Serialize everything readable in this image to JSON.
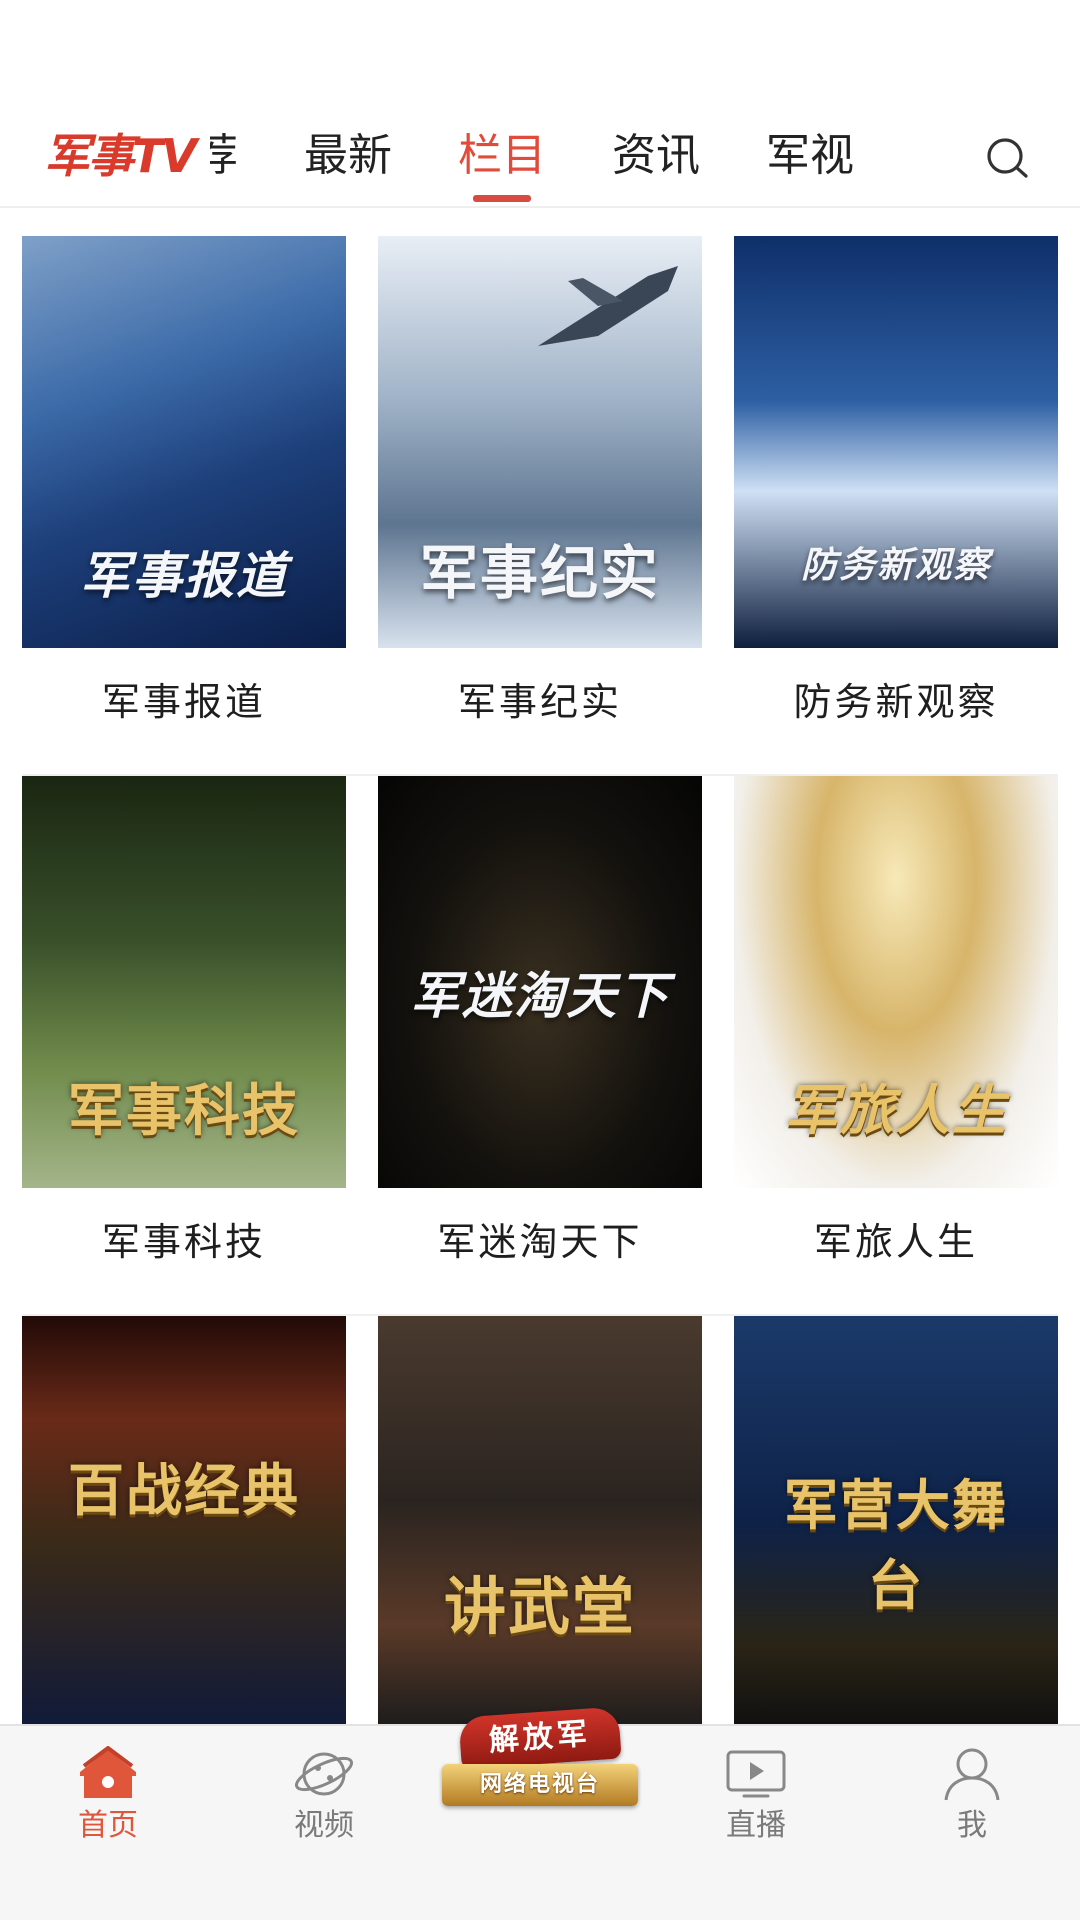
{
  "header": {
    "brand": "军事TV",
    "tabs": [
      "推荐",
      "最新",
      "栏目",
      "资讯",
      "军视"
    ],
    "active_tab": "栏目"
  },
  "programs": [
    {
      "title": "军事报道",
      "poster_text": "军事报道",
      "style": "silver"
    },
    {
      "title": "军事纪实",
      "poster_text": "军事纪实",
      "style": "silver"
    },
    {
      "title": "防务新观察",
      "poster_text": "防务新观察",
      "style": "silver"
    },
    {
      "title": "军事科技",
      "poster_text": "军事科技",
      "style": "gold"
    },
    {
      "title": "军迷淘天下",
      "poster_text": "军迷淘天下",
      "style": "silver"
    },
    {
      "title": "军旅人生",
      "poster_text": "军旅人生",
      "style": "gold"
    },
    {
      "title": "百战经典",
      "poster_text": "百战经典",
      "style": "gold"
    },
    {
      "title": "讲武堂",
      "poster_text": "讲武堂",
      "style": "gold"
    },
    {
      "title": "军营大舞台",
      "poster_text": "军营大舞台",
      "style": "gold"
    }
  ],
  "bottom_nav": {
    "home": "首页",
    "video": "视频",
    "center_top": "解放军",
    "center_bottom": "网络电视台",
    "live": "直播",
    "me": "我"
  },
  "colors": {
    "accent": "#e14b3b",
    "brand": "#d93a2b",
    "nav_inactive": "#7a7a7a"
  }
}
